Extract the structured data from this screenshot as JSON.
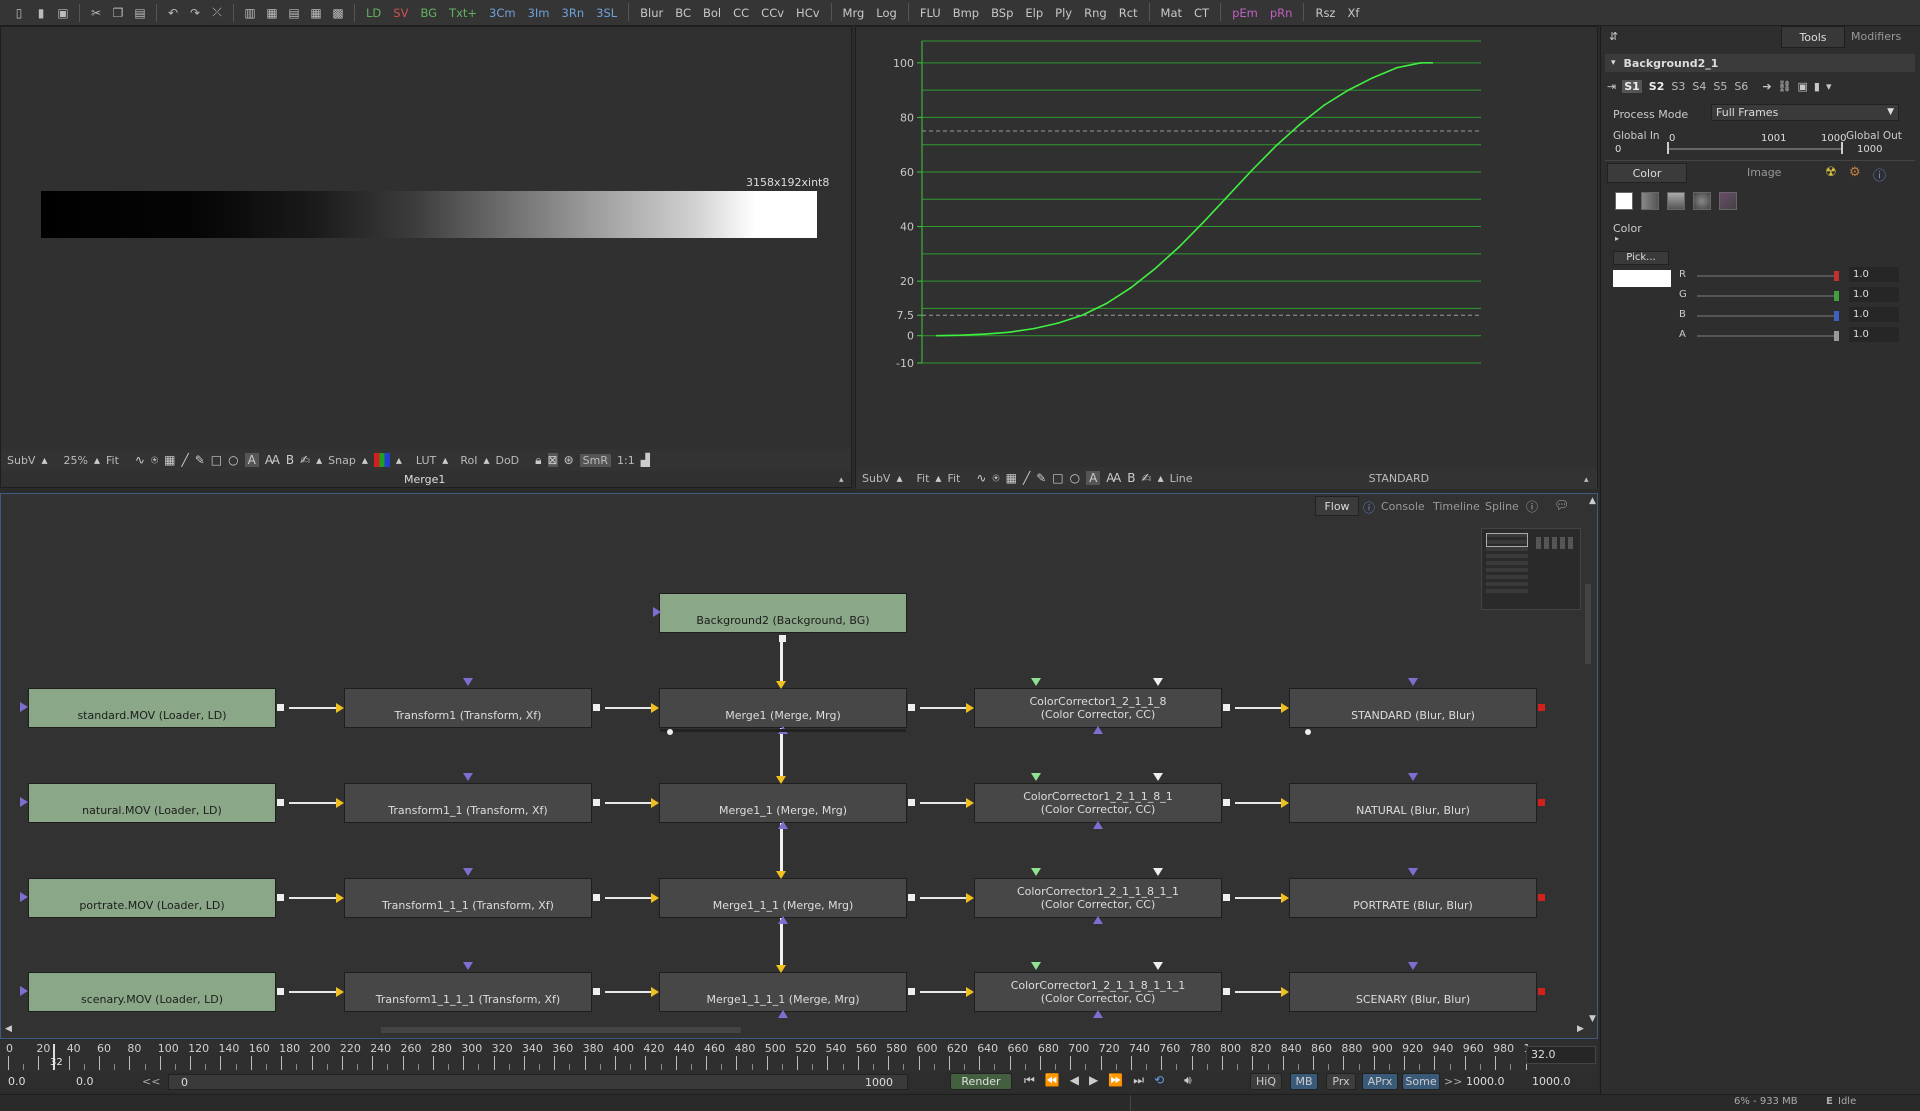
{
  "toolbar": {
    "items": [
      "LD",
      "SV",
      "BG",
      "Txt+",
      "3Cm",
      "3Im",
      "3Rn",
      "3SL",
      "Blur",
      "BC",
      "Bol",
      "CC",
      "CCv",
      "HCv",
      "Mrg",
      "Log",
      "FLU",
      "Bmp",
      "BSp",
      "Elp",
      "Ply",
      "Rng",
      "Rct",
      "Mat",
      "CT",
      "pEm",
      "pRn",
      "Rsz",
      "Xf"
    ],
    "colors": {
      "LD": "#5fb35f",
      "SV": "#d05050",
      "BG": "#5fb35f",
      "Txt+": "#5fb35f",
      "3Cm": "#6fa0d8",
      "3Im": "#6fa0d8",
      "3Rn": "#6fa0d8",
      "3SL": "#6fa0d8",
      "pEm": "#c060c0",
      "pRn": "#c060c0"
    }
  },
  "viewer1": {
    "resolution": "3158x192xint8",
    "name": "Merge1",
    "bar": {
      "subv": "SubV",
      "zoom": "25%",
      "fit": "Fit",
      "snap": "Snap",
      "lut": "LUT",
      "roi": "RoI",
      "dod": "DoD",
      "smr": "SmR",
      "ratio": "1:1"
    }
  },
  "viewer2": {
    "name": "STANDARD",
    "bar": {
      "subv": "SubV",
      "fit1": "Fit",
      "fit2": "Fit",
      "line": "Line"
    },
    "y_labels": [
      "100",
      "80",
      "60",
      "40",
      "20",
      "7.5",
      "0",
      "-10"
    ]
  },
  "chart_data": {
    "type": "line",
    "title": "",
    "xlabel": "",
    "ylabel": "",
    "ylim": [
      -10,
      108
    ],
    "x": [
      0,
      5,
      10,
      15,
      20,
      25,
      30,
      35,
      40,
      45,
      50,
      55,
      60,
      65,
      70,
      75,
      80,
      85,
      90,
      95,
      100
    ],
    "series": [
      {
        "values": [
          0,
          0.2,
          0.6,
          1.3,
          2.6,
          4.6,
          7.5,
          11.8,
          17.5,
          24.5,
          32.5,
          41.5,
          51,
          60.5,
          69.5,
          77.5,
          84.5,
          90,
          94.5,
          98.2,
          100
        ]
      }
    ],
    "grid": true,
    "dashed_lines": [
      75,
      7.5
    ]
  },
  "panel": {
    "tab_tools": "Tools",
    "tab_modifiers": "Modifiers",
    "tool_name": "Background2_1",
    "slots": [
      "S1",
      "S2",
      "S3",
      "S4",
      "S5",
      "S6"
    ],
    "process_mode_label": "Process Mode",
    "process_mode_value": "Full Frames",
    "global_in_label": "Global In",
    "global_out_label": "Global Out",
    "range_start": "0",
    "range_mid": "1001",
    "range_end": "1000",
    "global_in": "0",
    "global_out": "1000",
    "subtab_color": "Color",
    "subtab_image": "Image",
    "color_label": "Color",
    "pick_label": "Pick...",
    "channels": [
      {
        "name": "R",
        "value": "1.0",
        "color": "#c03030"
      },
      {
        "name": "G",
        "value": "1.0",
        "color": "#40a040"
      },
      {
        "name": "B",
        "value": "1.0",
        "color": "#4060c0"
      },
      {
        "name": "A",
        "value": "1.0",
        "color": "#999999"
      }
    ]
  },
  "flow": {
    "tabs": [
      "Flow",
      "Console",
      "Timeline",
      "Spline"
    ],
    "background_node": "Background2  (Background, BG)",
    "rows": [
      {
        "loader": "standard.MOV  (Loader, LD)",
        "transform": "Transform1  (Transform, Xf)",
        "merge": "Merge1  (Merge, Mrg)",
        "cc1": "ColorCorrector1_2_1_1_8",
        "cc2": "(Color Corrector, CC)",
        "blur": "STANDARD  (Blur, Blur)"
      },
      {
        "loader": "natural.MOV  (Loader, LD)",
        "transform": "Transform1_1  (Transform, Xf)",
        "merge": "Merge1_1  (Merge, Mrg)",
        "cc1": "ColorCorrector1_2_1_1_8_1",
        "cc2": "(Color Corrector, CC)",
        "blur": "NATURAL  (Blur, Blur)"
      },
      {
        "loader": "portrate.MOV  (Loader, LD)",
        "transform": "Transform1_1_1  (Transform, Xf)",
        "merge": "Merge1_1_1  (Merge, Mrg)",
        "cc1": "ColorCorrector1_2_1_1_8_1_1",
        "cc2": "(Color Corrector, CC)",
        "blur": "PORTRATE  (Blur, Blur)"
      },
      {
        "loader": "scenary.MOV  (Loader, LD)",
        "transform": "Transform1_1_1_1  (Transform, Xf)",
        "merge": "Merge1_1_1_1  (Merge, Mrg)",
        "cc1": "ColorCorrector1_2_1_1_8_1_1_1",
        "cc2": "(Color Corrector, CC)",
        "blur": "SCENARY  (Blur, Blur)"
      }
    ]
  },
  "timeline": {
    "ticks": [
      "0",
      "20",
      "40",
      "60",
      "80",
      "100",
      "120",
      "140",
      "160",
      "180",
      "200",
      "220",
      "240",
      "260",
      "280",
      "300",
      "320",
      "340",
      "360",
      "380",
      "400",
      "420",
      "440",
      "460",
      "480",
      "500",
      "520",
      "540",
      "560",
      "580",
      "600",
      "620",
      "640",
      "660",
      "680",
      "700",
      "720",
      "740",
      "760",
      "780",
      "800",
      "820",
      "840",
      "860",
      "880",
      "900",
      "920",
      "940",
      "960",
      "980",
      "1"
    ],
    "current_frame": "32",
    "current_frame_box": "32.0"
  },
  "transport": {
    "start": "0.0",
    "end": "0.0",
    "chev": "<<",
    "range_left": "0",
    "range_right": "1000",
    "render": "Render",
    "hiq": "HiQ",
    "mb": "MB",
    "prx": "Prx",
    "aprx": "APrx",
    "some": "Some",
    "chev2": ">>",
    "render_end": "1000.0",
    "global_end": "1000.0"
  },
  "status": {
    "memory": "6% - 933 MB",
    "state": "Idle"
  }
}
